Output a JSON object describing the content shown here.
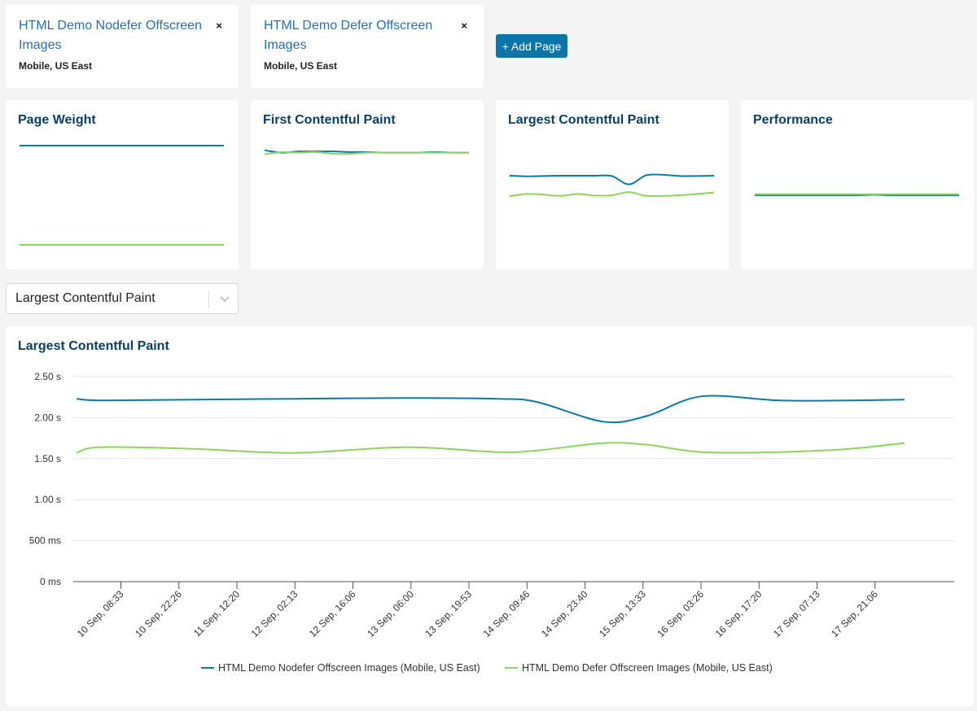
{
  "pages": [
    {
      "title": "HTML Demo Nodefer Offscreen Images",
      "subtitle": "Mobile, US East",
      "close_icon": "×"
    },
    {
      "title": "HTML Demo Defer Offscreen Images",
      "subtitle": "Mobile, US East",
      "close_icon": "×"
    }
  ],
  "add_page_label": "+ Add Page",
  "colors": {
    "series_1": "#0c7aa6",
    "series_2": "#8fd45d",
    "title": "#0d3f62",
    "link": "#2a6fae",
    "button": "#0c74a6"
  },
  "sparklines": [
    {
      "title": "Page Weight",
      "series": [
        {
          "values": [
            1,
            1,
            1,
            1,
            1,
            1,
            1,
            1,
            1,
            1,
            1,
            1,
            1
          ]
        },
        {
          "values": [
            0,
            0,
            0,
            0,
            0,
            0,
            0,
            0,
            0,
            0,
            0,
            0,
            0
          ]
        }
      ],
      "range": [
        0,
        1
      ]
    },
    {
      "title": "First Contentful Paint",
      "series": [
        {
          "values": [
            1.62,
            1.58,
            1.6,
            1.6,
            1.6,
            1.59,
            1.59,
            1.58,
            1.58,
            1.58,
            1.59,
            1.58,
            1.58
          ]
        },
        {
          "values": [
            1.55,
            1.59,
            1.58,
            1.59,
            1.56,
            1.56,
            1.58,
            1.58,
            1.58,
            1.58,
            1.58,
            1.58,
            1.58
          ]
        }
      ],
      "range": [
        0,
        1.7
      ]
    },
    {
      "title": "Largest Contentful Paint",
      "series": [
        {
          "values": [
            2.23,
            2.21,
            2.22,
            2.23,
            2.23,
            2.23,
            2.22,
            1.95,
            2.24,
            2.26,
            2.22,
            2.22,
            2.23
          ]
        },
        {
          "values": [
            1.57,
            1.64,
            1.62,
            1.58,
            1.64,
            1.59,
            1.6,
            1.7,
            1.58,
            1.58,
            1.6,
            1.64,
            1.69
          ]
        }
      ],
      "range": [
        0,
        3.2
      ]
    },
    {
      "title": "Performance",
      "series": [
        {
          "values": [
            0.5,
            0.5,
            0.5,
            0.5,
            0.5,
            0.5,
            0.5,
            0.505,
            0.5,
            0.5,
            0.5,
            0.5,
            0.5
          ]
        },
        {
          "values": [
            0.51,
            0.51,
            0.51,
            0.51,
            0.51,
            0.51,
            0.51,
            0.51,
            0.51,
            0.51,
            0.51,
            0.51,
            0.51
          ]
        }
      ],
      "range": [
        0,
        1
      ]
    }
  ],
  "metric_select": {
    "value": "Largest Contentful Paint"
  },
  "chart_data": {
    "type": "line",
    "title": "Largest Contentful Paint",
    "xlabel": "",
    "ylabel": "",
    "ylim": [
      0,
      2.5
    ],
    "y_ticks": [
      {
        "value": 0,
        "label": "0 ms"
      },
      {
        "value": 0.5,
        "label": "500 ms"
      },
      {
        "value": 1.0,
        "label": "1.00 s"
      },
      {
        "value": 1.5,
        "label": "1.50 s"
      },
      {
        "value": 2.0,
        "label": "2.00 s"
      },
      {
        "value": 2.5,
        "label": "2.50 s"
      }
    ],
    "x_unit": "hours since 10 Sep, 08:33",
    "xlim": [
      -11.4,
      199.5
    ],
    "x_ticks": [
      {
        "value": 0,
        "label": "10 Sep, 08:33"
      },
      {
        "value": 13.88,
        "label": "10 Sep, 22:26"
      },
      {
        "value": 27.78,
        "label": "11 Sep, 12:20"
      },
      {
        "value": 41.67,
        "label": "12 Sep, 02:13"
      },
      {
        "value": 55.55,
        "label": "12 Sep, 16:06"
      },
      {
        "value": 69.45,
        "label": "13 Sep, 06:00"
      },
      {
        "value": 83.33,
        "label": "13 Sep, 19:53"
      },
      {
        "value": 97.22,
        "label": "14 Sep, 09:46"
      },
      {
        "value": 111.12,
        "label": "14 Sep, 23:40"
      },
      {
        "value": 125.0,
        "label": "15 Sep, 13:33"
      },
      {
        "value": 138.88,
        "label": "16 Sep, 03:26"
      },
      {
        "value": 152.78,
        "label": "16 Sep, 17:20"
      },
      {
        "value": 166.67,
        "label": "17 Sep, 07:13"
      },
      {
        "value": 180.55,
        "label": "17 Sep, 21:06"
      }
    ],
    "grid": true,
    "legend": "bottom",
    "x": [
      -10.6,
      -5.0,
      17.4,
      41.7,
      67.9,
      90.3,
      99.7,
      115.6,
      125.9,
      139.0,
      157.7,
      174.5,
      187.6
    ],
    "series": [
      {
        "name": "HTML Demo Nodefer Offscreen Images (Mobile, US East)",
        "color": "#0c7aa6",
        "values": [
          2.23,
          2.21,
          2.22,
          2.23,
          2.24,
          2.23,
          2.19,
          1.95,
          2.02,
          2.26,
          2.21,
          2.21,
          2.22
        ]
      },
      {
        "name": "HTML Demo Defer Offscreen Images (Mobile, US East)",
        "color": "#8fd45d",
        "values": [
          1.57,
          1.64,
          1.62,
          1.57,
          1.64,
          1.58,
          1.6,
          1.69,
          1.67,
          1.58,
          1.58,
          1.62,
          1.69
        ]
      }
    ]
  }
}
